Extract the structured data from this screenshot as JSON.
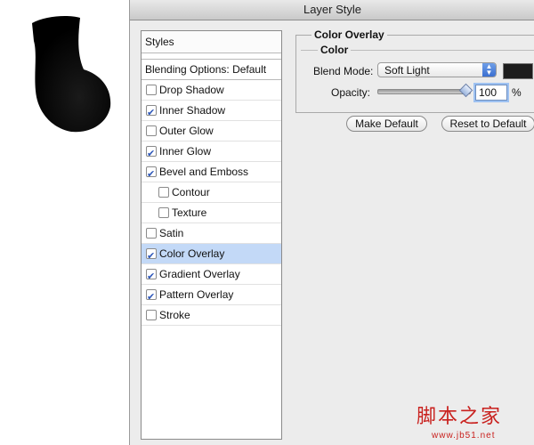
{
  "dialog": {
    "title": "Layer Style"
  },
  "styles_panel": {
    "header": "Styles",
    "blending_options": "Blending Options: Default",
    "items": [
      {
        "label": "Drop Shadow",
        "checked": false,
        "indent": false,
        "selected": false
      },
      {
        "label": "Inner Shadow",
        "checked": true,
        "indent": false,
        "selected": false
      },
      {
        "label": "Outer Glow",
        "checked": false,
        "indent": false,
        "selected": false
      },
      {
        "label": "Inner Glow",
        "checked": true,
        "indent": false,
        "selected": false
      },
      {
        "label": "Bevel and Emboss",
        "checked": true,
        "indent": false,
        "selected": false
      },
      {
        "label": "Contour",
        "checked": false,
        "indent": true,
        "selected": false
      },
      {
        "label": "Texture",
        "checked": false,
        "indent": true,
        "selected": false
      },
      {
        "label": "Satin",
        "checked": false,
        "indent": false,
        "selected": false
      },
      {
        "label": "Color Overlay",
        "checked": true,
        "indent": false,
        "selected": true
      },
      {
        "label": "Gradient Overlay",
        "checked": true,
        "indent": false,
        "selected": false
      },
      {
        "label": "Pattern Overlay",
        "checked": true,
        "indent": false,
        "selected": false
      },
      {
        "label": "Stroke",
        "checked": false,
        "indent": false,
        "selected": false
      }
    ]
  },
  "color_overlay": {
    "group_title": "Color Overlay",
    "subgroup_title": "Color",
    "blend_mode_label": "Blend Mode:",
    "blend_mode_value": "Soft Light",
    "overlay_color": "#1d1d1d",
    "opacity_label": "Opacity:",
    "opacity_value": "100",
    "opacity_unit": "%",
    "make_default_label": "Make Default",
    "reset_default_label": "Reset to Default"
  },
  "watermark": {
    "text": "脚本之家",
    "url": "www.jb51.net"
  }
}
